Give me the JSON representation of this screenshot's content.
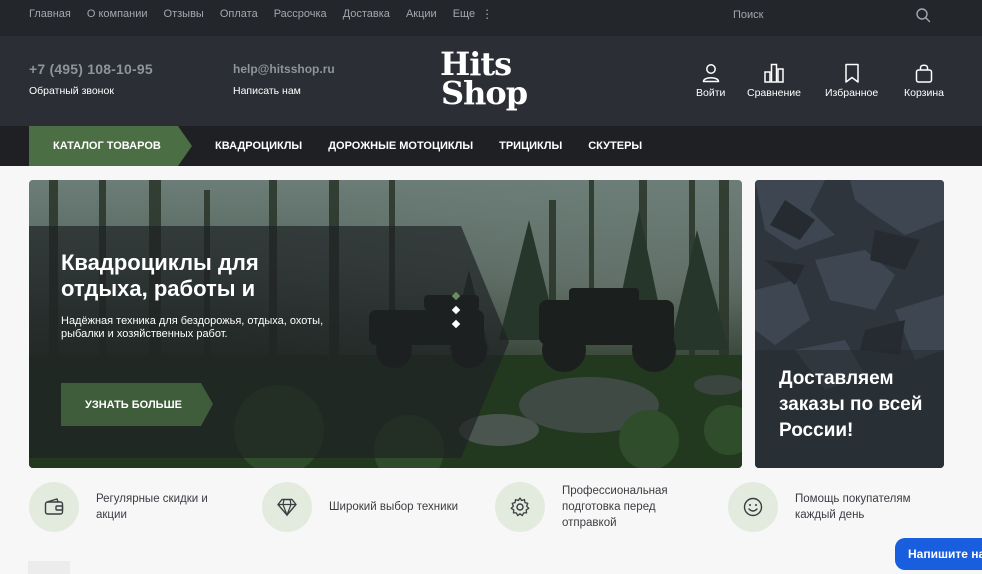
{
  "topbar": {
    "nav": [
      "Главная",
      "О компании",
      "Отзывы",
      "Оплата",
      "Рассрочка",
      "Доставка",
      "Акции",
      "Еще"
    ],
    "more_icon": "⋮",
    "search_placeholder": "Поиск"
  },
  "header": {
    "phone": "+7 (495) 108-10-95",
    "callback": "Обратный звонок",
    "email": "help@hitsshop.ru",
    "write_us": "Написать нам",
    "logo_line1": "Hits",
    "logo_line2": "Shop",
    "actions": {
      "login": "Войти",
      "compare": "Сравнение",
      "favorites": "Избранное",
      "cart": "Корзина"
    }
  },
  "catalog_nav": {
    "catalog_button": "КАТАЛОГ ТОВАРОВ",
    "links": [
      "КВАДРОЦИКЛЫ",
      "ДОРОЖНЫЕ МОТОЦИКЛЫ",
      "ТРИЦИКЛЫ",
      "СКУТЕРЫ"
    ]
  },
  "hero": {
    "title": "Квадроциклы для отдыха, работы и",
    "subtitle": "Надёжная техника для бездорожья, отдыха, охоты, рыбалки и хозяйственных работ.",
    "button": "УЗНАТЬ БОЛЬШЕ",
    "slides": 3,
    "active_slide": 1
  },
  "promo": {
    "text": "Доставляем заказы по всей России!"
  },
  "features": [
    {
      "icon": "wallet-icon",
      "text": "Регулярные скидки и акции"
    },
    {
      "icon": "diamond-icon",
      "text": "Широкий выбор техники"
    },
    {
      "icon": "gear-icon",
      "text": "Профессиональная подготовка перед отправкой"
    },
    {
      "icon": "smile-icon",
      "text": "Помощь покупателям каждый день"
    }
  ],
  "chat": {
    "label": "Напишите на"
  },
  "colors": {
    "accent_green": "#4b6e44",
    "topbar_bg": "#23262b",
    "header_bg": "#2b2e34",
    "nav_bg": "#1e2024",
    "chat_blue": "#1a5ee0"
  }
}
